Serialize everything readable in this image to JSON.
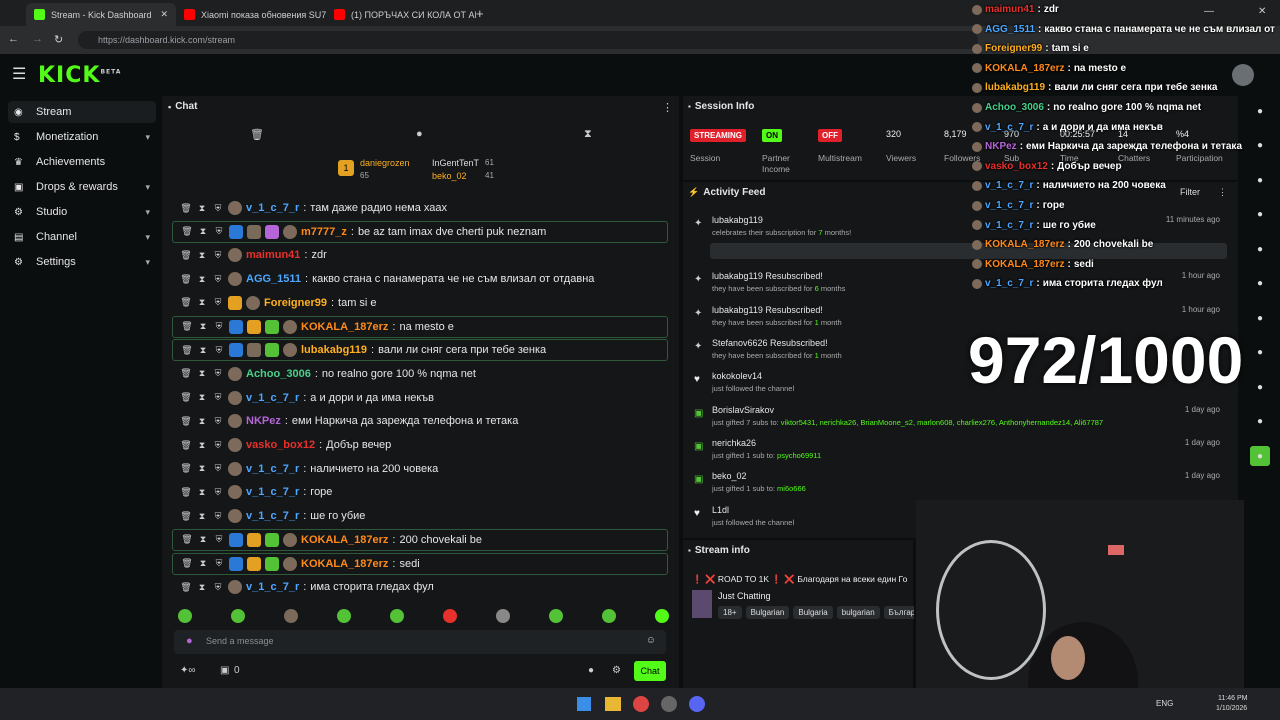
{
  "browser": {
    "tabs": [
      {
        "title": "Stream - Kick Dashboard",
        "color": "#53fc18"
      },
      {
        "title": "Xiaomi показа обновения SU7",
        "color": "#ff0000"
      },
      {
        "title": "(1) ПОРЪЧАХ СИ КОЛА ОТ АМ...",
        "color": "#ff0000"
      }
    ],
    "url": "https://dashboard.kick.com/stream"
  },
  "app": {
    "logo": "KICK",
    "logo_sup": "BETA"
  },
  "sidebar": {
    "items": [
      {
        "label": "Stream",
        "icon": "broadcast-icon"
      },
      {
        "label": "Monetization",
        "icon": "dollar-icon",
        "chev": "▾"
      },
      {
        "label": "Achievements",
        "icon": "trophy-icon"
      },
      {
        "label": "Drops & rewards",
        "icon": "gift-icon",
        "chev": "▾"
      },
      {
        "label": "Studio",
        "icon": "studio-icon",
        "chev": "▾"
      },
      {
        "label": "Channel",
        "icon": "channel-icon",
        "chev": "▾"
      },
      {
        "label": "Settings",
        "icon": "gear-icon",
        "chev": "▾"
      }
    ]
  },
  "chat": {
    "title": "Chat",
    "leaderboard": {
      "first": {
        "name": "daniegrozen",
        "count": "65"
      },
      "second": {
        "name": "InGentTenT",
        "count": "61"
      },
      "third": {
        "name": "beko_02",
        "count": "41"
      },
      "rank": "1"
    },
    "messages": [
      {
        "user": "v_1_c_7_r",
        "color": "#4da6ff",
        "text": "там даже радио нема хаах",
        "hl": false,
        "badges": []
      },
      {
        "user": "m7777_z",
        "color": "#ff8a1c",
        "text": "be az tam imax dve cherti puk neznam",
        "hl": true,
        "badges": [
          "#2b79d6",
          "#7a6a5a",
          "#b565d8"
        ]
      },
      {
        "user": "maimun41",
        "color": "#e8302c",
        "text": "zdr",
        "hl": false,
        "badges": []
      },
      {
        "user": "AGG_1511",
        "color": "#4da6ff",
        "text": "какво стана с панамерата че не съм влизал от отдавна",
        "hl": false,
        "badges": []
      },
      {
        "user": "Foreigner99",
        "color": "#ffb020",
        "text": "tam si e",
        "hl": false,
        "badges": [
          "#e3a021"
        ]
      },
      {
        "user": "KOKALA_187erz",
        "color": "#ff8a1c",
        "text": "na mesto e",
        "hl": true,
        "badges": [
          "#2b79d6",
          "#e3a021",
          "#53c236"
        ]
      },
      {
        "user": "lubakabg119",
        "color": "#ffb020",
        "text": "вали ли сняг сега при тебе зенка",
        "hl": true,
        "badges": [
          "#2b79d6",
          "#7a6a5a",
          "#53c236"
        ]
      },
      {
        "user": "Achoo_3006",
        "color": "#48d08a",
        "text": "no realno gore 100 % nqma net",
        "hl": false,
        "badges": []
      },
      {
        "user": "v_1_c_7_r",
        "color": "#4da6ff",
        "text": "а и дори и да има некъв",
        "hl": false,
        "badges": []
      },
      {
        "user": "NKPez",
        "color": "#b565d8",
        "text": "еми Наркича да зарежда телефона и тетака",
        "hl": false,
        "badges": []
      },
      {
        "user": "vasko_box12",
        "color": "#e8302c",
        "text": "Добър вечер",
        "hl": false,
        "badges": []
      },
      {
        "user": "v_1_c_7_r",
        "color": "#4da6ff",
        "text": "наличието на 200 човека",
        "hl": false,
        "badges": []
      },
      {
        "user": "v_1_c_7_r",
        "color": "#4da6ff",
        "text": "горе",
        "hl": false,
        "badges": []
      },
      {
        "user": "v_1_c_7_r",
        "color": "#4da6ff",
        "text": "ше го убие",
        "hl": false,
        "badges": []
      },
      {
        "user": "KOKALA_187erz",
        "color": "#ff8a1c",
        "text": "200 chovekali be",
        "hl": true,
        "badges": [
          "#2b79d6",
          "#e3a021",
          "#53c236"
        ]
      },
      {
        "user": "KOKALA_187erz",
        "color": "#ff8a1c",
        "text": "sedi",
        "hl": true,
        "badges": [
          "#2b79d6",
          "#e3a021",
          "#53c236"
        ]
      },
      {
        "user": "v_1_c_7_r",
        "color": "#4da6ff",
        "text": "има сторита гледах фул",
        "hl": false,
        "badges": []
      }
    ],
    "input_placeholder": "Send a message",
    "points": "0",
    "send_label": "Chat"
  },
  "session": {
    "title": "Session Info",
    "stats": [
      {
        "value": "STREAMING",
        "label": "Session",
        "kind": "red"
      },
      {
        "value": "ON",
        "label": "Partner Income",
        "kind": "green"
      },
      {
        "value": "OFF",
        "label": "Multistream",
        "kind": "red"
      },
      {
        "value": "320",
        "label": "Viewers"
      },
      {
        "value": "8,179",
        "label": "Followers"
      },
      {
        "value": "970",
        "label": "Sub"
      },
      {
        "value": "00:25:57",
        "label": "Time"
      },
      {
        "value": "14",
        "label": "Chatters"
      },
      {
        "value": "%4",
        "label": "Participation"
      }
    ]
  },
  "activity": {
    "title": "Activity Feed",
    "filter": "Filter",
    "items": [
      {
        "name": "lubakabg119",
        "desc": "celebrates their subscription for ",
        "highlight": "7",
        "desc2": " months!",
        "time": "11 minutes ago",
        "icon": "star-icon"
      },
      {
        "name": "lubakabg119 Resubscribed!",
        "desc": "they have been subscribed for ",
        "highlight": "6",
        "desc2": " months",
        "time": "1 hour ago",
        "icon": "star-icon"
      },
      {
        "name": "lubakabg119 Resubscribed!",
        "desc": "they have been subscribed for ",
        "highlight": "1",
        "desc2": " month",
        "time": "1 hour ago",
        "icon": "star-icon"
      },
      {
        "name": "Stefanov6626 Resubscribed!",
        "desc": "they have been subscribed for ",
        "highlight": "1",
        "desc2": " month",
        "time": "",
        "icon": "star-icon"
      },
      {
        "name": "kokokolev14",
        "desc": "just followed the channel",
        "highlight": "",
        "desc2": "",
        "time": "",
        "icon": "heart-icon"
      },
      {
        "name": "BorislavSirakov",
        "desc": "just gifted 7 subs to: ",
        "highlight": "viktor5431, nerichka26, BrianMoone_s2, marlon608, charliex276, Anthonyhernandez14, Ali67787",
        "desc2": "",
        "time": "1 day ago",
        "icon": "gift-icon"
      },
      {
        "name": "nerichka26",
        "desc": "just gifted 1 sub to: ",
        "highlight": "psycho69911",
        "desc2": "",
        "time": "1 day ago",
        "icon": "gift-icon"
      },
      {
        "name": "beko_02",
        "desc": "just gifted 1 sub to: ",
        "highlight": "mi6o666",
        "desc2": "",
        "time": "1 day ago",
        "icon": "gift-icon"
      },
      {
        "name": "L1dl",
        "desc": "just followed the channel",
        "highlight": "",
        "desc2": "",
        "time": "",
        "icon": "heart-icon"
      }
    ]
  },
  "streaminfo": {
    "title": "Stream info",
    "stream_title": "❗ ❌ ROAD TO 1K ❗ ❌ Благодаря на всеки един Го",
    "category": "Just Chatting",
    "tags": [
      "18+",
      "Bulgarian",
      "Bulgaria",
      "bulgarian",
      "Българ"
    ]
  },
  "overlay": {
    "counter": "972/1000",
    "messages": [
      {
        "user": "maimun41",
        "color": "#e8302c",
        "text": "zdr"
      },
      {
        "user": "AGG_1511",
        "color": "#4da6ff",
        "text": "какво стана с панамерата че не съм влизал от"
      },
      {
        "user": "Foreigner99",
        "color": "#ffb020",
        "text": "tam si e"
      },
      {
        "user": "KOKALA_187erz",
        "color": "#ff8a1c",
        "text": "na mesto e"
      },
      {
        "user": "lubakabg119",
        "color": "#ffb020",
        "text": "вали ли сняг сега при тебе зенка"
      },
      {
        "user": "Achoo_3006",
        "color": "#48d08a",
        "text": "no realno gore 100 % nqma net"
      },
      {
        "user": "v_1_c_7_r",
        "color": "#4da6ff",
        "text": "а и дори и да има некъв"
      },
      {
        "user": "NKPez",
        "color": "#b565d8",
        "text": "еми Наркича да зарежда телефона и тетака"
      },
      {
        "user": "vasko_box12",
        "color": "#e8302c",
        "text": "Добър вечер"
      },
      {
        "user": "v_1_c_7_r",
        "color": "#4da6ff",
        "text": "наличието на 200 човека"
      },
      {
        "user": "v_1_c_7_r",
        "color": "#4da6ff",
        "text": "горе"
      },
      {
        "user": "v_1_c_7_r",
        "color": "#4da6ff",
        "text": "ше го убие"
      },
      {
        "user": "KOKALA_187erz",
        "color": "#ff8a1c",
        "text": "200 chovekali be"
      },
      {
        "user": "KOKALA_187erz",
        "color": "#ff8a1c",
        "text": "sedi"
      },
      {
        "user": "v_1_c_7_r",
        "color": "#4da6ff",
        "text": "има сторита гледах фул"
      }
    ]
  },
  "taskbar": {
    "lang": "ENG",
    "time": "11:46 PM",
    "date": "1/10/2026"
  }
}
